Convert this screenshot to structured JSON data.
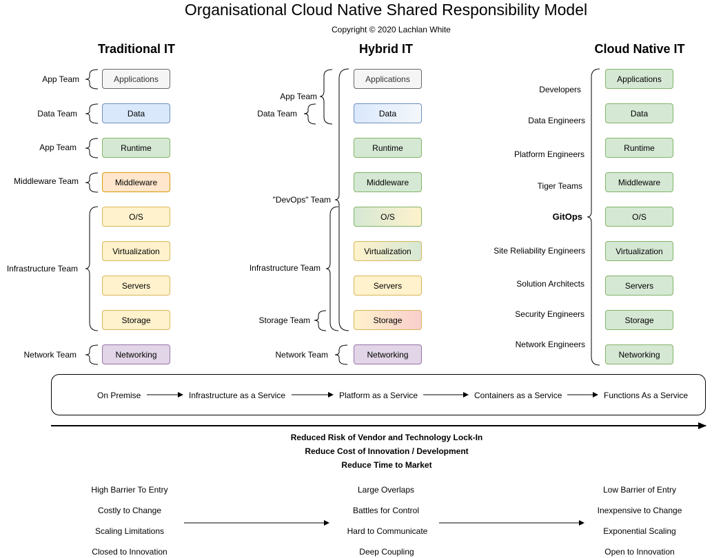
{
  "title": "Organisational Cloud Native Shared Responsibility Model",
  "copyright": "Copyright © 2020 Lachlan White",
  "columns": {
    "traditional": {
      "heading": "Traditional IT",
      "layers": [
        "Applications",
        "Data",
        "Runtime",
        "Middleware",
        "O/S",
        "Virtualization",
        "Servers",
        "Storage",
        "Networking"
      ],
      "teams": [
        "App Team",
        "Data Team",
        "App Team",
        "Middleware Team",
        "Infrastructure Team",
        "Network Team"
      ]
    },
    "hybrid": {
      "heading": "Hybrid IT",
      "layers": [
        "Applications",
        "Data",
        "Runtime",
        "Middleware",
        "O/S",
        "Virtualization",
        "Servers",
        "Storage",
        "Networking"
      ],
      "teams": [
        "App Team",
        "Data Team",
        "\"DevOps\" Team",
        "Infrastructure Team",
        "Storage Team",
        "Network Team"
      ]
    },
    "cloud": {
      "heading": "Cloud Native IT",
      "layers": [
        "Applications",
        "Data",
        "Runtime",
        "Middleware",
        "O/S",
        "Virtualization",
        "Servers",
        "Storage",
        "Networking"
      ],
      "roles": [
        "Developers",
        "Data Engineers",
        "Platform Engineers",
        "Tiger Teams",
        "Site Reliability Engineers",
        "Solution Architects",
        "Security Engineers",
        "Network Engineers"
      ],
      "gitops": "GitOps"
    }
  },
  "flow": [
    "On Premise",
    "Infrastructure as a Service",
    "Platform as a Service",
    "Containers as a Service",
    "Functions As a Service"
  ],
  "benefits": [
    "Reduced Risk of Vendor and Technology Lock-In",
    "Reduce Cost of Innovation / Development",
    "Reduce Time to Market"
  ],
  "comparison": {
    "left": [
      "High Barrier To Entry",
      "Costly to Change",
      "Scaling Limitations",
      "Closed to Innovation"
    ],
    "middle": [
      "Large Overlaps",
      "Battles for Control",
      "Hard to Communicate",
      "Deep Coupling"
    ],
    "right": [
      "Low Barrier of Entry",
      "Inexpensive to Change",
      "Exponential Scaling",
      "Open to Innovation"
    ]
  },
  "colors": {
    "grey": "#f5f5f5",
    "blue": "#dae8fc",
    "green": "#d5e8d4",
    "orange": "#ffe6cc",
    "yellow": "#fff2cc",
    "purple": "#e1d5e7",
    "red": "#f8cecc"
  }
}
